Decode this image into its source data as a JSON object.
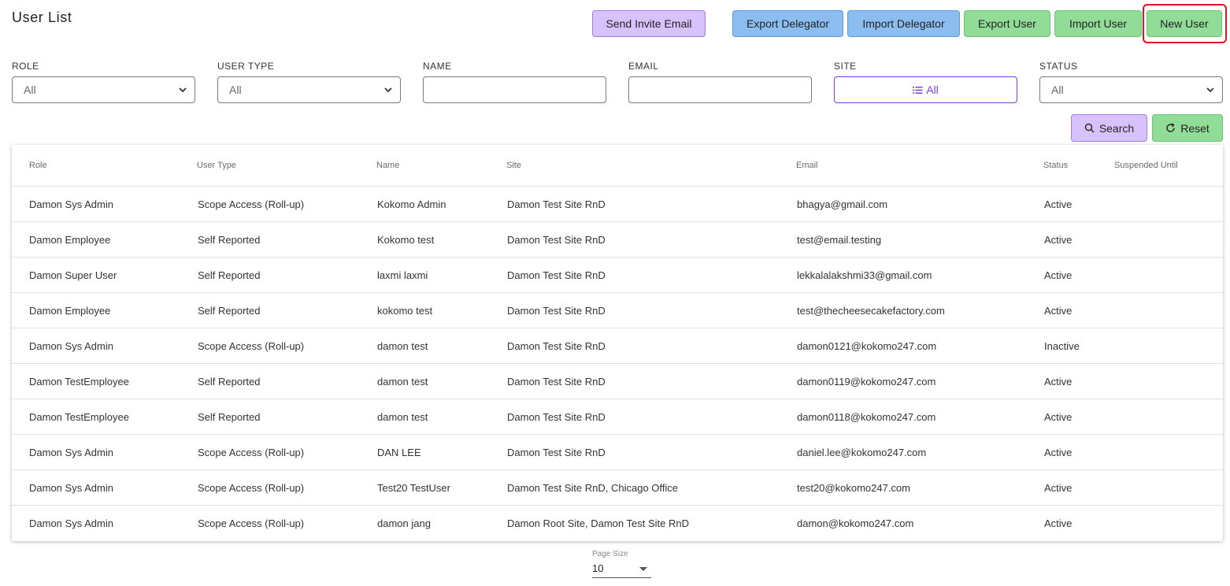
{
  "page": {
    "title": "User List"
  },
  "toolbar": {
    "send_invite": "Send Invite Email",
    "export_delegator": "Export Delegator",
    "import_delegator": "Import Delegator",
    "export_user": "Export User",
    "import_user": "Import User",
    "new_user": "New User"
  },
  "filters": {
    "role": {
      "label": "ROLE",
      "value": "All"
    },
    "user_type": {
      "label": "USER TYPE",
      "value": "All"
    },
    "name": {
      "label": "NAME",
      "value": ""
    },
    "email": {
      "label": "EMAIL",
      "value": ""
    },
    "site": {
      "label": "SITE",
      "value": "All"
    },
    "status": {
      "label": "STATUS",
      "value": "All"
    }
  },
  "actions": {
    "search": "Search",
    "reset": "Reset"
  },
  "table": {
    "headers": [
      "Role",
      "User Type",
      "Name",
      "Site",
      "Email",
      "Status",
      "Suspended Until"
    ],
    "rows": [
      [
        "Damon Sys Admin",
        "Scope Access (Roll-up)",
        "Kokomo Admin",
        "Damon Test Site RnD",
        "bhagya@gmail.com",
        "Active",
        ""
      ],
      [
        "Damon Employee",
        "Self Reported",
        "Kokomo test",
        "Damon Test Site RnD",
        "test@email.testing",
        "Active",
        ""
      ],
      [
        "Damon Super User",
        "Self Reported",
        "laxmi laxmi",
        "Damon Test Site RnD",
        "lekkalalakshmi33@gmail.com",
        "Active",
        ""
      ],
      [
        "Damon Employee",
        "Self Reported",
        "kokomo test",
        "Damon Test Site RnD",
        "test@thecheesecakefactory.com",
        "Active",
        ""
      ],
      [
        "Damon Sys Admin",
        "Scope Access (Roll-up)",
        "damon test",
        "Damon Test Site RnD",
        "damon0121@kokomo247.com",
        "Inactive",
        ""
      ],
      [
        "Damon TestEmployee",
        "Self Reported",
        "damon test",
        "Damon Test Site RnD",
        "damon0119@kokomo247.com",
        "Active",
        ""
      ],
      [
        "Damon TestEmployee",
        "Self Reported",
        "damon test",
        "Damon Test Site RnD",
        "damon0118@kokomo247.com",
        "Active",
        ""
      ],
      [
        "Damon Sys Admin",
        "Scope Access (Roll-up)",
        "DAN LEE",
        "Damon Test Site RnD",
        "daniel.lee@kokomo247.com",
        "Active",
        ""
      ],
      [
        "Damon Sys Admin",
        "Scope Access (Roll-up)",
        "Test20 TestUser",
        "Damon Test Site RnD, Chicago Office",
        "test20@kokomo247.com",
        "Active",
        ""
      ],
      [
        "Damon Sys Admin",
        "Scope Access (Roll-up)",
        "damon jang",
        "Damon Root Site, Damon Test Site RnD",
        "damon@kokomo247.com",
        "Active",
        ""
      ]
    ]
  },
  "pagination": {
    "label": "Page Size",
    "value": "10"
  },
  "colors": {
    "purple_button": "#d8c2fb",
    "blue_button": "#8bbdf0",
    "green_button": "#91dc97",
    "site_accent": "#7b3fd6",
    "highlight": "#e0141b"
  }
}
